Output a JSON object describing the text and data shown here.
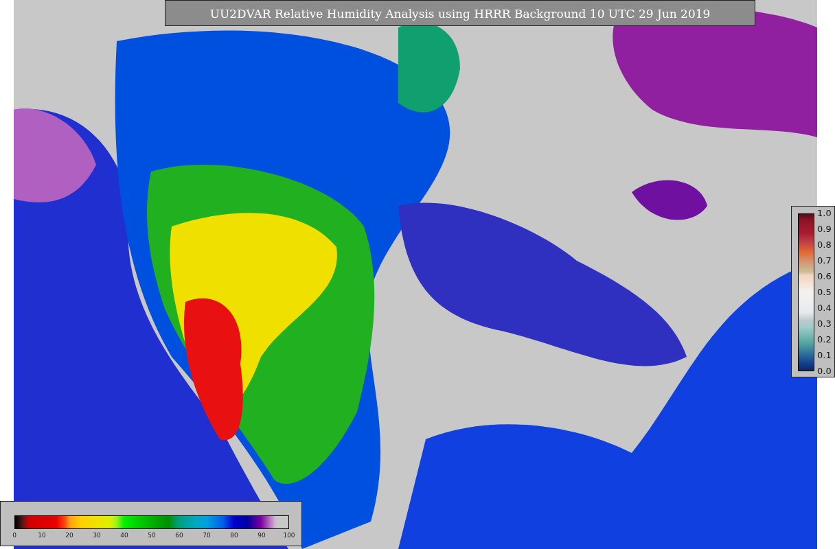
{
  "title": "UU2DVAR Relative Humidity Analysis using HRRR Background 10 UTC 29 Jun 2019",
  "colorbars": [
    {
      "kind": "vertical",
      "ticks": [
        "1.0",
        "0.9",
        "0.8",
        "0.7",
        "0.6",
        "0.5",
        "0.4",
        "0.3",
        "0.2",
        "0.1",
        "0.0"
      ]
    },
    {
      "kind": "horizontal",
      "ticks": [
        "0",
        "10",
        "20",
        "30",
        "40",
        "50",
        "60",
        "70",
        "80",
        "90",
        "100"
      ]
    }
  ]
}
